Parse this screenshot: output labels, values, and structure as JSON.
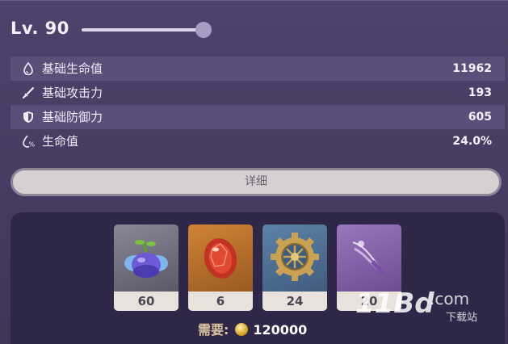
{
  "level": {
    "label": "Lv. 90",
    "slider_fraction": 1.0
  },
  "stats": [
    {
      "icon": "droplet-icon",
      "label": "基础生命值",
      "value": "11962"
    },
    {
      "icon": "sword-icon",
      "label": "基础攻击力",
      "value": "193"
    },
    {
      "icon": "shield-icon",
      "label": "基础防御力",
      "value": "605"
    },
    {
      "icon": "droplet-percent-icon",
      "label": "生命值",
      "value": "24.0%"
    }
  ],
  "detail_button": {
    "label": "详细"
  },
  "materials": [
    {
      "icon": "berry-flower-icon",
      "count": "60",
      "bg": "#6c6a78"
    },
    {
      "icon": "red-gem-icon",
      "count": "6",
      "bg": "#b8702e"
    },
    {
      "icon": "gear-icon",
      "count": "24",
      "bg": "#4f6f92"
    },
    {
      "icon": "feather-icon",
      "count": "20",
      "bg": "#8a66a8"
    }
  ],
  "requirement": {
    "label": "需要:",
    "value": "120000",
    "currency_icon": "mora-coin-icon"
  },
  "watermark": {
    "text": "11Bd",
    "domain": ".com",
    "sub": "下载站"
  }
}
